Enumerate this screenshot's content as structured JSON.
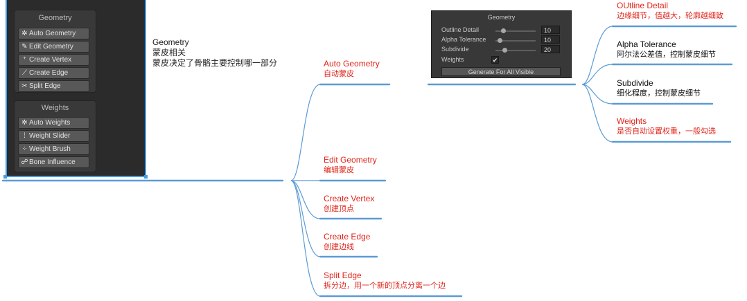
{
  "colors": {
    "link": "#5b9bd5",
    "node_red": "#e0251b",
    "node_dark": "#111111",
    "panel_bg": "#2b2b2b",
    "selection": "#3e9ee6"
  },
  "tool_panel": {
    "groups": [
      {
        "title": "Geometry",
        "buttons": [
          {
            "icon": "auto-geometry-icon",
            "label": "Auto Geometry"
          },
          {
            "icon": "edit-geometry-icon",
            "label": "Edit Geometry"
          },
          {
            "icon": "create-vertex-icon",
            "label": "Create Vertex"
          },
          {
            "icon": "create-edge-icon",
            "label": "Create Edge"
          },
          {
            "icon": "split-edge-icon",
            "label": "Split Edge"
          }
        ]
      },
      {
        "title": "Weights",
        "buttons": [
          {
            "icon": "auto-weights-icon",
            "label": "Auto Weights"
          },
          {
            "icon": "weight-slider-icon",
            "label": "Weight Slider"
          },
          {
            "icon": "weight-brush-icon",
            "label": "Weight Brush"
          },
          {
            "icon": "bone-influence-icon",
            "label": "Bone Influence"
          }
        ]
      }
    ]
  },
  "inspector": {
    "title": "Geometry",
    "rows": [
      {
        "label": "Outline Detail",
        "value": "10",
        "level": 0.15
      },
      {
        "label": "Alpha Tolerance",
        "value": "10",
        "level": 0.05
      },
      {
        "label": "Subdivide",
        "value": "20",
        "level": 0.2
      }
    ],
    "weights_label": "Weights",
    "weights_checked": true,
    "checkmark": "✔",
    "button": "Generate For All Visible"
  },
  "mindmap": {
    "root": {
      "title": "Geometry",
      "line1": "蒙皮相关",
      "line2": "蒙皮决定了骨骼主要控制哪一部分"
    },
    "branches": [
      {
        "title": "Auto Geometry",
        "desc": "自动蒙皮"
      },
      {
        "title": "Edit Geometry",
        "desc": "编辑蒙皮"
      },
      {
        "title": "Create Vertex",
        "desc": "创建顶点"
      },
      {
        "title": "Create Edge",
        "desc": "创建边线"
      },
      {
        "title": "Split Edge",
        "desc": "拆分边，用一个新的顶点分离一个边"
      }
    ],
    "auto_geometry_children": [
      {
        "title": "OUtline Detail",
        "desc": "边缘细节，值越大，轮廓越细致"
      },
      {
        "title": "Alpha Tolerance",
        "desc": "阿尔法公差值，控制蒙皮细节"
      },
      {
        "title": "Subdivide",
        "desc": "细化程度，控制蒙皮细节"
      },
      {
        "title": "Weights",
        "desc": "是否自动设置权重，一般勾选"
      }
    ]
  }
}
